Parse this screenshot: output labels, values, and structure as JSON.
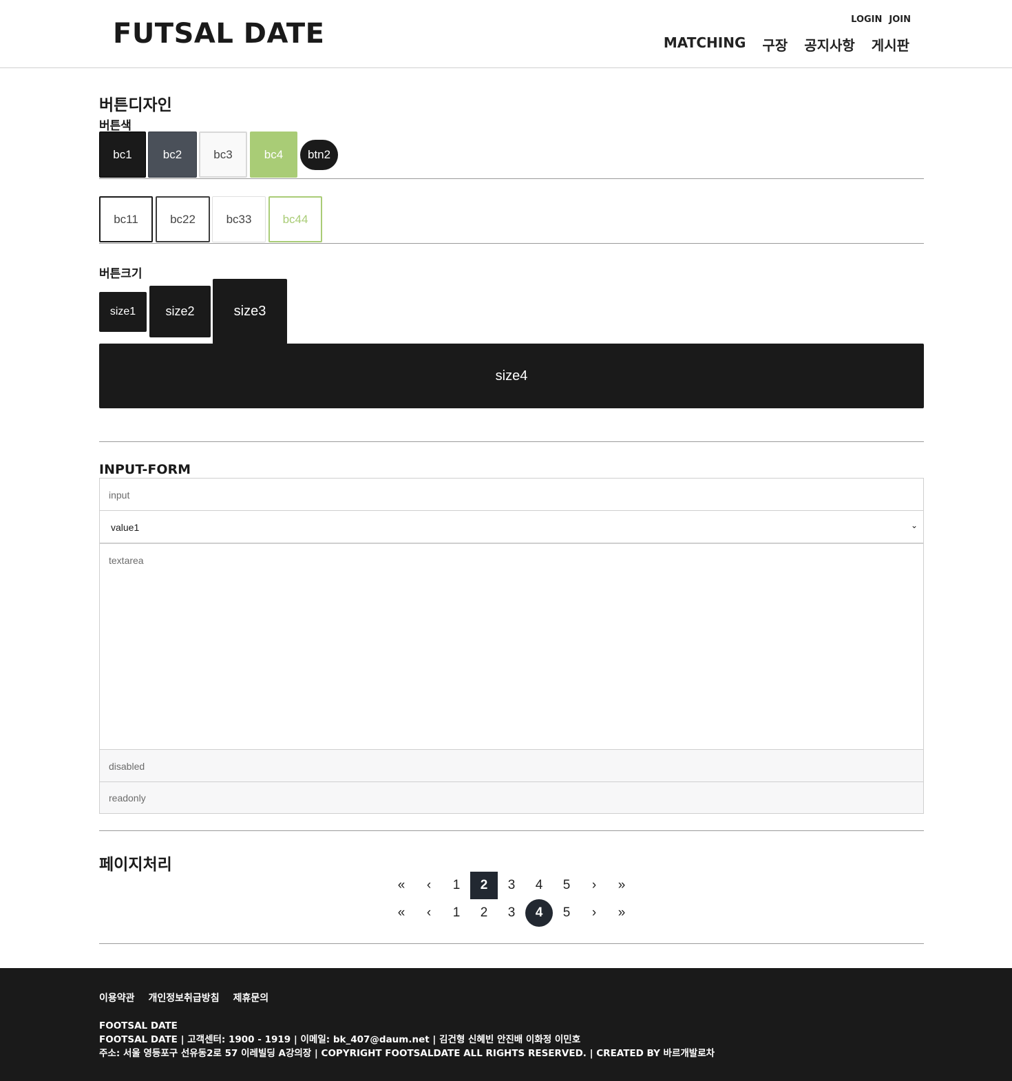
{
  "header": {
    "logo": "FUTSAL DATE",
    "util": {
      "login": "LOGIN",
      "join": "JOIN"
    },
    "nav": [
      "MATCHING",
      "구장",
      "공지사항",
      "게시판"
    ]
  },
  "buttons": {
    "title": "버튼디자인",
    "color_title": "버튼색",
    "row1": [
      "bc1",
      "bc2",
      "bc3",
      "bc4",
      "btn2"
    ],
    "row2": [
      "bc11",
      "bc22",
      "bc33",
      "bc44"
    ],
    "size_title": "버튼크기",
    "sizes": [
      "size1",
      "size2",
      "size3",
      "size4"
    ]
  },
  "form": {
    "title": "INPUT-FORM",
    "input_placeholder": "input",
    "select_value": "value1",
    "textarea_placeholder": "textarea",
    "disabled_placeholder": "disabled",
    "readonly_placeholder": "readonly"
  },
  "pagination": {
    "title": "페이지처리",
    "first": "«",
    "prev": "‹",
    "next": "›",
    "last": "»",
    "pages": [
      "1",
      "2",
      "3",
      "4",
      "5"
    ],
    "active_row1": "2",
    "active_row2": "4"
  },
  "footer": {
    "links": [
      "이용약관",
      "개인정보취급방침",
      "제휴문의"
    ],
    "brand": "FOOTSAL DATE",
    "line1": "FOOTSAL DATE | 고객센터: 1900 - 1919 | 이메일: bk_407@daum.net | 김건형 신혜빈 안진배 이화정 이민호",
    "line2": "주소: 서울 영등포구 선유동2로 57 이레빌딩 A강의장 | COPYRIGHT FOOTSALDATE ALL RIGHTS RESERVED. | CREATED BY 바르개발로차"
  }
}
